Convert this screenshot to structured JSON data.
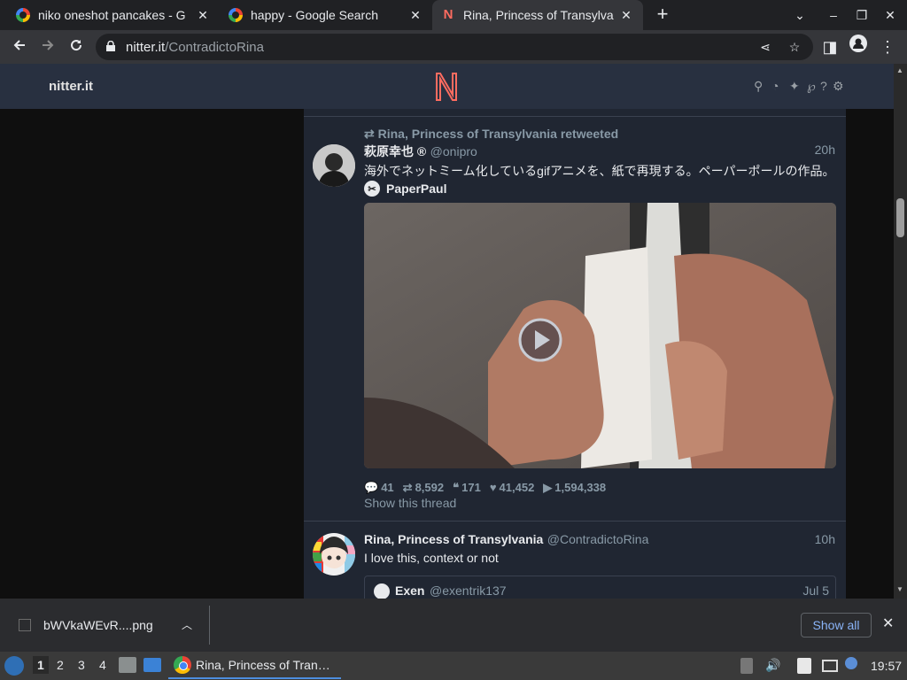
{
  "tabs": [
    {
      "title": "niko oneshot pancakes - G",
      "close": "✕"
    },
    {
      "title": "happy - Google Search",
      "close": "✕"
    },
    {
      "title": "Rina, Princess of Transylva",
      "close": "✕"
    }
  ],
  "new_tab": "+",
  "window_controls": {
    "dropdown": "⌄",
    "minimize": "–",
    "restore": "❐",
    "close": "✕"
  },
  "url": {
    "host": "nitter.it",
    "path": "/ContradictoRina"
  },
  "nitter": {
    "site_name": "nitter.it",
    "logo_letter": "N"
  },
  "tweet1": {
    "retweet_header": "Rina, Princess of Transylvania retweeted",
    "user": "萩原幸也 ®",
    "handle": "@onipro",
    "time": "20h",
    "text": "海外でネットミーム化しているgifアニメを、紙で再現する。ペーパーポールの作品。",
    "card_user": "PaperPaul",
    "stats": {
      "replies": "41",
      "retweets": "8,592",
      "quotes": "171",
      "likes": "41,452",
      "views": "1,594,338"
    },
    "show_thread": "Show this thread"
  },
  "tweet2": {
    "user": "Rina, Princess of Transylvania",
    "handle": "@ContradictoRina",
    "time": "10h",
    "text": "I love this, context or not",
    "quote_user": "Exen",
    "quote_handle": "@exentrik137",
    "quote_time": "Jul 5"
  },
  "downloads": {
    "file": "bWVkaWEvR....png",
    "show_all": "Show all"
  },
  "taskbar": {
    "workspaces": [
      "1",
      "2",
      "3",
      "4"
    ],
    "task_title": "Rina, Princess of Tran…",
    "clock": "19:57"
  }
}
